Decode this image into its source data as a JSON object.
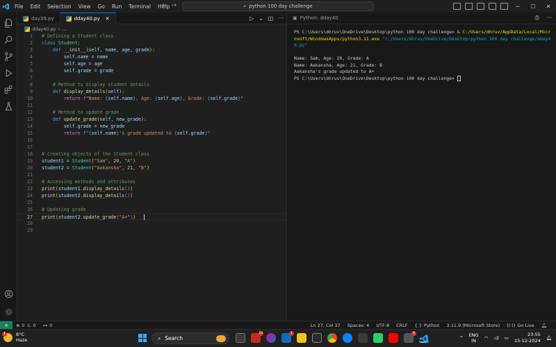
{
  "menu": [
    "File",
    "Edit",
    "Selection",
    "View",
    "Go",
    "Run",
    "Terminal",
    "Help"
  ],
  "search_text": "python 100 day challenge",
  "tabs": [
    {
      "label": "day39.py",
      "active": false
    },
    {
      "label": "dday40.py",
      "active": true
    }
  ],
  "breadcrumb": "dday40.py",
  "breadcrumb_tail": "...",
  "editor": {
    "line_numbers": [
      "1",
      "2",
      "3",
      "4",
      "5",
      "6",
      "7",
      "8",
      "9",
      "10",
      "11",
      "12",
      "13",
      "14",
      "15",
      "16",
      "17",
      "18",
      "19",
      "20",
      "21",
      "22",
      "23",
      "24",
      "25",
      "26",
      "27",
      "28",
      "29"
    ],
    "current_line": "27"
  },
  "terminal": {
    "tab_label": "Python: dday40",
    "prompt": "PS C:\\Users\\dhruv\\OneDrive\\Desktop\\python 100 day challenge> ",
    "exe_path": "& C:/Users/dhruv/AppData/Local/Microsoft/WindowsApps/python3.11.exe",
    "script_path": " \"c:/Users/dhruv/OneDrive/Desktop/python 100 day challenge/dday40.py\"",
    "output": [
      "Name: Sam, Age: 20, Grade: A",
      "Name: Aakansha, Age: 21, Grade: B",
      "Aakansha's grade updated to A+"
    ],
    "final_prompt": "PS C:\\Users\\dhruv\\OneDrive\\Desktop\\python 100 day challenge> "
  },
  "status": {
    "errors": "0",
    "warnings": "0",
    "ports": "0",
    "position": "Ln 27, Col 37",
    "spaces": "Spaces: 4",
    "encoding": "UTF-8",
    "eol": "CRLF",
    "language": "Python",
    "interpreter": "3.11.9 (Microsoft Store)",
    "golive": "Go Live"
  },
  "taskbar": {
    "temp": "8°C",
    "weather": "Haze",
    "weather_badge": "1",
    "search_label": "Search",
    "lang_1": "ENG",
    "lang_2": "IN",
    "time": "23:55",
    "date": "15-12-2024",
    "badges": [
      "51",
      "1",
      "6"
    ]
  },
  "colors": {
    "accent": "#0078d4",
    "remote": "#16825d"
  }
}
